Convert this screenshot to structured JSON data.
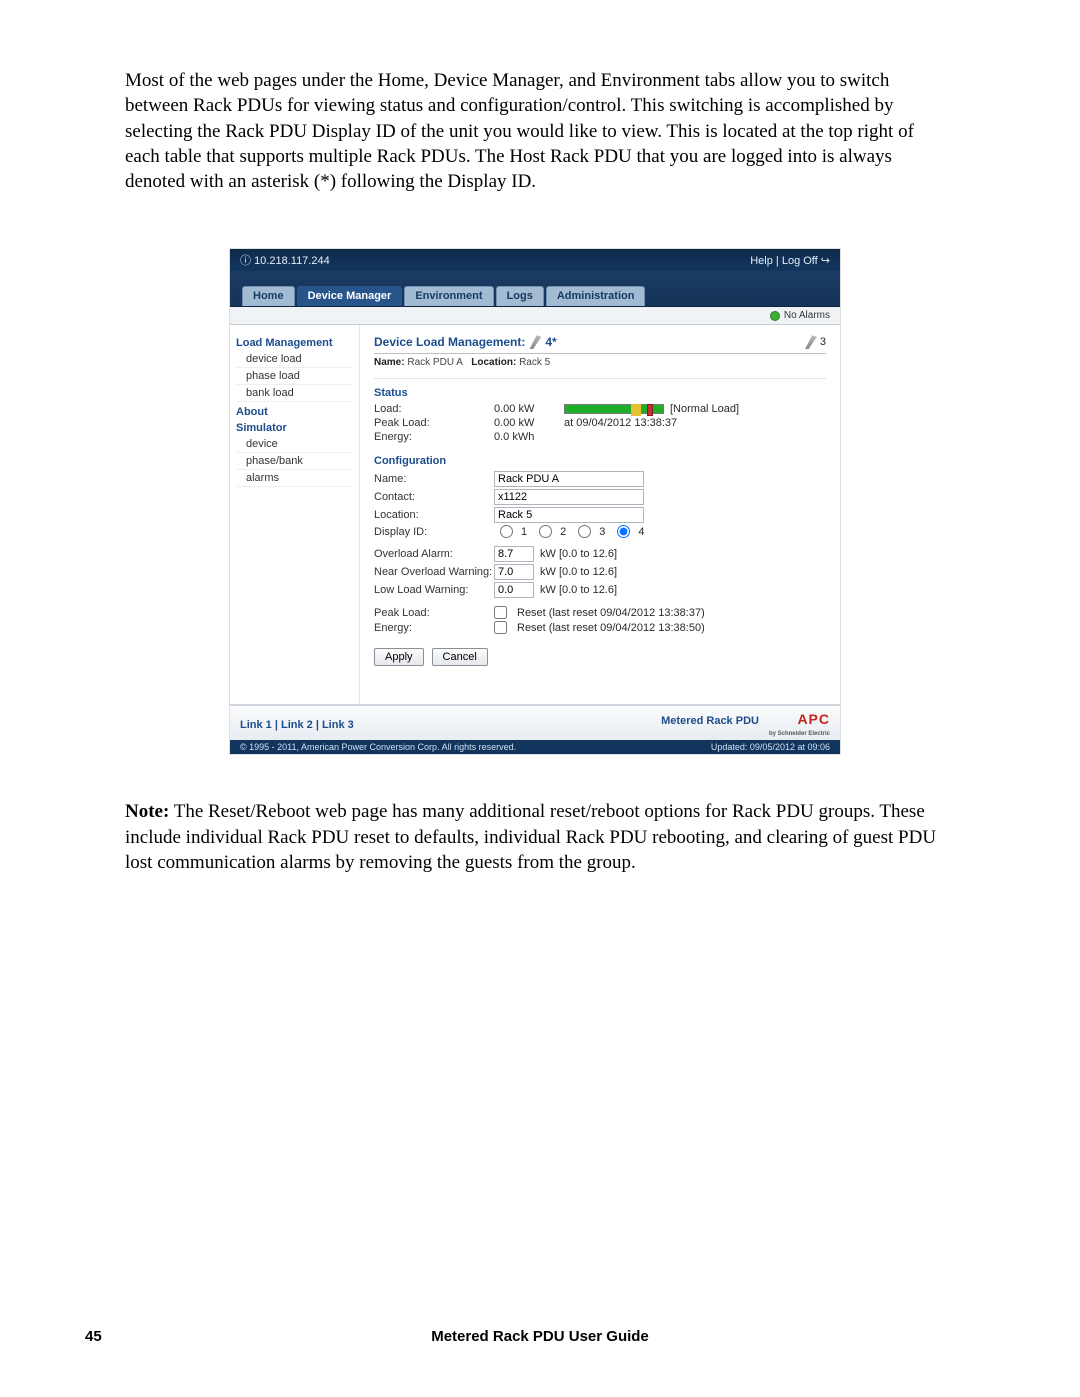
{
  "intro": "Most of the web pages under the Home, Device Manager, and Environment tabs allow you to switch between Rack PDUs for viewing status and configuration/control.  This switching is accomplished by selecting the Rack PDU Display ID of the unit you would like to view.  This is located at the top right of each table that supports multiple Rack PDUs.  The Host Rack PDU that you are logged into is always denoted with an asterisk (*) following the Display ID.",
  "ip": "10.218.117.244",
  "top": {
    "help": "Help",
    "logoff": "Log Off"
  },
  "tabs": {
    "home": "Home",
    "devmgr": "Device Manager",
    "env": "Environment",
    "logs": "Logs",
    "admin": "Administration"
  },
  "alarm": "No Alarms",
  "sidebar": {
    "loadmgmt": "Load Management",
    "device_load": "device load",
    "phase_load": "phase load",
    "bank_load": "bank load",
    "about": "About",
    "simulator": "Simulator",
    "device": "device",
    "phase_bank": "phase/bank",
    "alarms": "alarms"
  },
  "title": "Device Load Management:",
  "title_id": "4*",
  "title_right": "3",
  "subline": {
    "name_l": "Name:",
    "name_v": "Rack PDU A",
    "loc_l": "Location:",
    "loc_v": "Rack 5"
  },
  "status": {
    "hdr": "Status",
    "load_l": "Load:",
    "load_v": "0.00 kW",
    "load_note": "[Normal Load]",
    "peak_l": "Peak Load:",
    "peak_v": "0.00 kW",
    "peak_note": "at 09/04/2012 13:38:37",
    "energy_l": "Energy:",
    "energy_v": "0.0 kWh"
  },
  "config": {
    "hdr": "Configuration",
    "name_l": "Name:",
    "name_v": "Rack PDU A",
    "contact_l": "Contact:",
    "contact_v": "x1122",
    "location_l": "Location:",
    "location_v": "Rack 5",
    "display_l": "Display ID:",
    "disp": {
      "a": "1",
      "b": "2",
      "c": "3",
      "d": "4"
    },
    "ov_l": "Overload Alarm:",
    "ov_v": "8.7",
    "ov_r": "kW [0.0 to 12.6]",
    "nv_l": "Near Overload Warning:",
    "nv_v": "7.0",
    "nv_r": "kW [0.0 to 12.6]",
    "lw_l": "Low Load Warning:",
    "lw_v": "0.0",
    "lw_r": "kW [0.0 to 12.6]",
    "pk_l": "Peak Load:",
    "pk_r": "Reset (last reset 09/04/2012 13:38:37)",
    "en_l": "Energy:",
    "en_r": "Reset (last reset 09/04/2012 13:38:50)",
    "apply": "Apply",
    "cancel": "Cancel"
  },
  "footer": {
    "links": "Link 1 | Link 2 | Link 3",
    "product": "Metered Rack PDU",
    "apc": "APC",
    "by": "by Schneider Electric",
    "copy": "© 1995 - 2011, American Power Conversion Corp. All rights reserved.",
    "updated": "Updated: 09/05/2012 at 09:06"
  },
  "note_l": "Note:",
  "note_b": " The Reset/Reboot web page has many additional reset/reboot options for Rack PDU groups.  These include individual Rack PDU reset to defaults, individual Rack PDU rebooting, and clearing of guest PDU lost communication alarms by removing the guests from the group.",
  "pgnum": "45",
  "pgtitle": "Metered Rack PDU User Guide"
}
